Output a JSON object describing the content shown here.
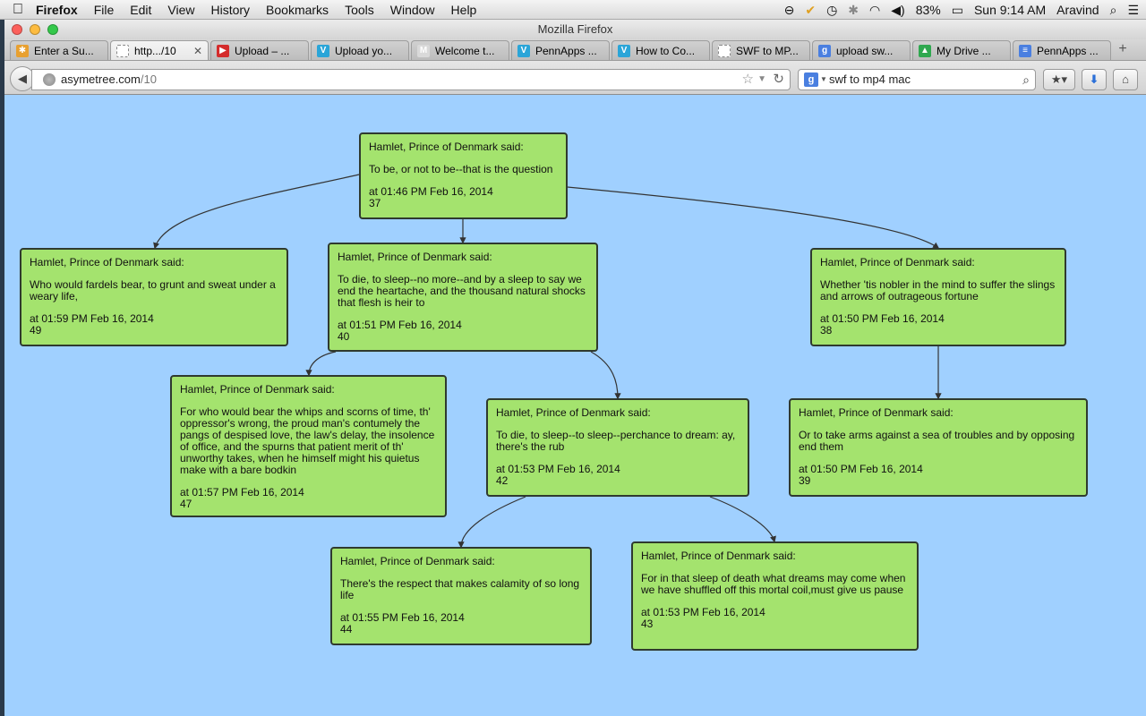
{
  "menubar": {
    "app": "Firefox",
    "menus": [
      "File",
      "Edit",
      "View",
      "History",
      "Bookmarks",
      "Tools",
      "Window",
      "Help"
    ],
    "battery": "83%",
    "clock": "Sun 9:14 AM",
    "user": "Aravind"
  },
  "window": {
    "title": "Mozilla Firefox"
  },
  "tabs": [
    {
      "label": "Enter a Su...",
      "icon": "pinwheel-icon",
      "color": "#e8a030",
      "glyph": "✱"
    },
    {
      "label": "http.../10",
      "icon": "blank-page-icon",
      "color": "#ffffff",
      "glyph": "",
      "active": true
    },
    {
      "label": "Upload – ...",
      "icon": "youtube-icon",
      "color": "#d42b2b",
      "glyph": "▶"
    },
    {
      "label": "Upload yo...",
      "icon": "vimeo-icon",
      "color": "#2aa5d8",
      "glyph": "V"
    },
    {
      "label": "Welcome t...",
      "icon": "gmail-icon",
      "color": "#d9d9d9",
      "glyph": "M"
    },
    {
      "label": "PennApps ...",
      "icon": "vimeo-icon",
      "color": "#2aa5d8",
      "glyph": "V"
    },
    {
      "label": "How to Co...",
      "icon": "vimeo-icon",
      "color": "#2aa5d8",
      "glyph": "V"
    },
    {
      "label": "SWF to MP...",
      "icon": "blank-page-icon",
      "color": "#ffffff",
      "glyph": ""
    },
    {
      "label": "upload sw...",
      "icon": "google-icon",
      "color": "#4a7fe0",
      "glyph": "g"
    },
    {
      "label": "My Drive ...",
      "icon": "drive-icon",
      "color": "#2fa84f",
      "glyph": "▲"
    },
    {
      "label": "PennApps ...",
      "icon": "doc-icon",
      "color": "#4a7fe0",
      "glyph": "≡"
    }
  ],
  "address": {
    "host": "asymetree.com",
    "path": "/10"
  },
  "search": {
    "value": "swf to mp4 mac"
  },
  "colors": {
    "page_bg": "#a0d0ff",
    "node_bg": "#a4e36e",
    "node_border": "#2f3a2f"
  },
  "nodes": [
    {
      "id": "n37",
      "speaker": "Hamlet, Prince of Denmark said:",
      "text": "To be, or not to be--that is the question",
      "time": "at 01:46 PM Feb 16, 2014",
      "num": "37"
    },
    {
      "id": "n49",
      "speaker": "Hamlet, Prince of Denmark said:",
      "text": "Who would fardels bear, to grunt and sweat under a weary life,",
      "time": "at 01:59 PM Feb 16, 2014",
      "num": "49"
    },
    {
      "id": "n40",
      "speaker": "Hamlet, Prince of Denmark said:",
      "text": "To die, to sleep--no more--and by a sleep to say we end the heartache, and the thousand natural shocks that flesh is heir to",
      "time": "at 01:51 PM Feb 16, 2014",
      "num": "40"
    },
    {
      "id": "n38",
      "speaker": "Hamlet, Prince of Denmark said:",
      "text": "Whether 'tis nobler in the mind to suffer the slings and arrows of outrageous fortune",
      "time": "at 01:50 PM Feb 16, 2014",
      "num": "38"
    },
    {
      "id": "n47",
      "speaker": "Hamlet, Prince of Denmark said:",
      "text": "For who would bear the whips and scorns of time, th' oppressor's wrong, the proud man's contumely the pangs of despised love, the law's delay, the insolence of office, and the spurns that patient merit of th' unworthy takes, when he himself might his quietus make with a bare bodkin",
      "time": "at 01:57 PM Feb 16, 2014",
      "num": "47"
    },
    {
      "id": "n42",
      "speaker": "Hamlet, Prince of Denmark said:",
      "text": "To die, to sleep--to sleep--perchance to dream: ay, there's the rub",
      "time": "at 01:53 PM Feb 16, 2014",
      "num": "42"
    },
    {
      "id": "n39",
      "speaker": "Hamlet, Prince of Denmark said:",
      "text": "Or to take arms against a sea of troubles and by opposing end them",
      "time": "at 01:50 PM Feb 16, 2014",
      "num": "39"
    },
    {
      "id": "n44",
      "speaker": "Hamlet, Prince of Denmark said:",
      "text": "There's the respect that makes calamity of so long life",
      "time": "at 01:55 PM Feb 16, 2014",
      "num": "44"
    },
    {
      "id": "n43",
      "speaker": "Hamlet, Prince of Denmark said:",
      "text": "For in that sleep of death what dreams may come when we have shuffled off this mortal coil,must give us pause",
      "time": "at 01:53 PM Feb 16, 2014",
      "num": "43"
    }
  ],
  "edges": [
    {
      "from": "n37",
      "to": "n49"
    },
    {
      "from": "n37",
      "to": "n40"
    },
    {
      "from": "n37",
      "to": "n38"
    },
    {
      "from": "n40",
      "to": "n47"
    },
    {
      "from": "n40",
      "to": "n42"
    },
    {
      "from": "n38",
      "to": "n39"
    },
    {
      "from": "n42",
      "to": "n44"
    },
    {
      "from": "n42",
      "to": "n43"
    }
  ]
}
